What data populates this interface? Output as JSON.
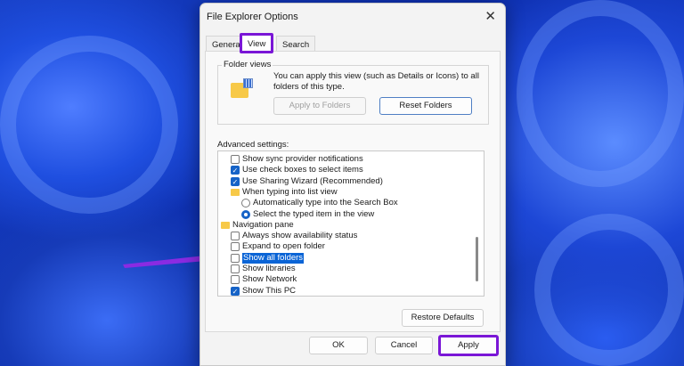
{
  "dialog": {
    "title": "File Explorer Options",
    "close": "✕"
  },
  "tabs": [
    {
      "label": "General"
    },
    {
      "label": "View"
    },
    {
      "label": "Search"
    }
  ],
  "folder_views": {
    "label": "Folder views",
    "text": "You can apply this view (such as Details or Icons) to all folders of this type.",
    "apply_button": "Apply to Folders",
    "reset_button": "Reset Folders"
  },
  "advanced": {
    "label": "Advanced settings:",
    "items": [
      {
        "label": "Show sync provider notifications",
        "type": "checkbox",
        "checked": false
      },
      {
        "label": "Use check boxes to select items",
        "type": "checkbox",
        "checked": true
      },
      {
        "label": "Use Sharing Wizard (Recommended)",
        "type": "checkbox",
        "checked": true
      },
      {
        "label": "When typing into list view",
        "type": "folder"
      },
      {
        "label": "Automatically type into the Search Box",
        "type": "radio",
        "checked": false
      },
      {
        "label": "Select the typed item in the view",
        "type": "radio",
        "checked": true
      },
      {
        "label": "Navigation pane",
        "type": "nav"
      },
      {
        "label": "Always show availability status",
        "type": "checkbox",
        "checked": false
      },
      {
        "label": "Expand to open folder",
        "type": "checkbox",
        "checked": false
      },
      {
        "label": "Show all folders",
        "type": "checkbox",
        "checked": false,
        "selected": true
      },
      {
        "label": "Show libraries",
        "type": "checkbox",
        "checked": false
      },
      {
        "label": "Show Network",
        "type": "checkbox",
        "checked": false
      },
      {
        "label": "Show This PC",
        "type": "checkbox",
        "checked": true
      }
    ]
  },
  "restore_button": "Restore Defaults",
  "footer": {
    "ok": "OK",
    "cancel": "Cancel",
    "apply": "Apply"
  },
  "colors": {
    "highlight": "#7a16d6",
    "accent": "#1663c7"
  }
}
